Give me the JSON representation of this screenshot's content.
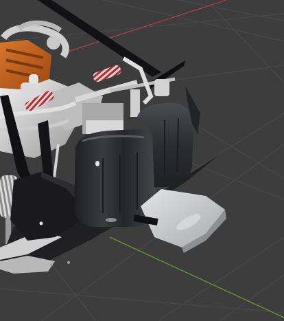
{
  "viewport": {
    "background": "#3d3d3d",
    "grid_color": "#4a4a4a",
    "axis_x_color": "#b04049",
    "axis_y_color": "#6b9a2c",
    "model_colors": {
      "engine_orange": "#c8611b",
      "engine_metal": "#d6d6d6",
      "spring_red": "#b8282c",
      "bumper_dark": "#1c1c1e",
      "tank_dark": "#2a2b2f",
      "exhaust_light": "#cfd0d2"
    }
  }
}
